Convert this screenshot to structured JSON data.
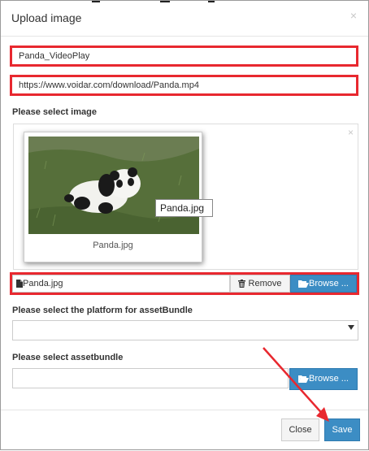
{
  "dialog": {
    "title": "Upload image",
    "close_glyph": "×"
  },
  "fields": {
    "name_value": "Panda_VideoPlay",
    "url_value": "https://www.voidar.com/download/Panda.mp4"
  },
  "image_section": {
    "label": "Please select image",
    "preview_close_glyph": "×",
    "thumbnail_caption": "Panda.jpg",
    "tooltip": "Panda.jpg",
    "file_name": "Panda.jpg",
    "remove_label": "Remove",
    "browse_label": "Browse ..."
  },
  "platform_section": {
    "label": "Please select the platform for assetBundle",
    "selected_value": ""
  },
  "assetbundle_section": {
    "label": "Please select assetbundle",
    "file_value": "",
    "browse_label": "Browse ..."
  },
  "footer": {
    "close_label": "Close",
    "save_label": "Save"
  },
  "colors": {
    "highlight": "#e8282f",
    "primary": "#3c8dc4",
    "arrow": "#e8282f"
  },
  "icons": {
    "file": "file-icon",
    "trash": "trash-icon",
    "folder": "folder-open-icon",
    "caret": "caret-down-icon",
    "close": "close-icon"
  }
}
